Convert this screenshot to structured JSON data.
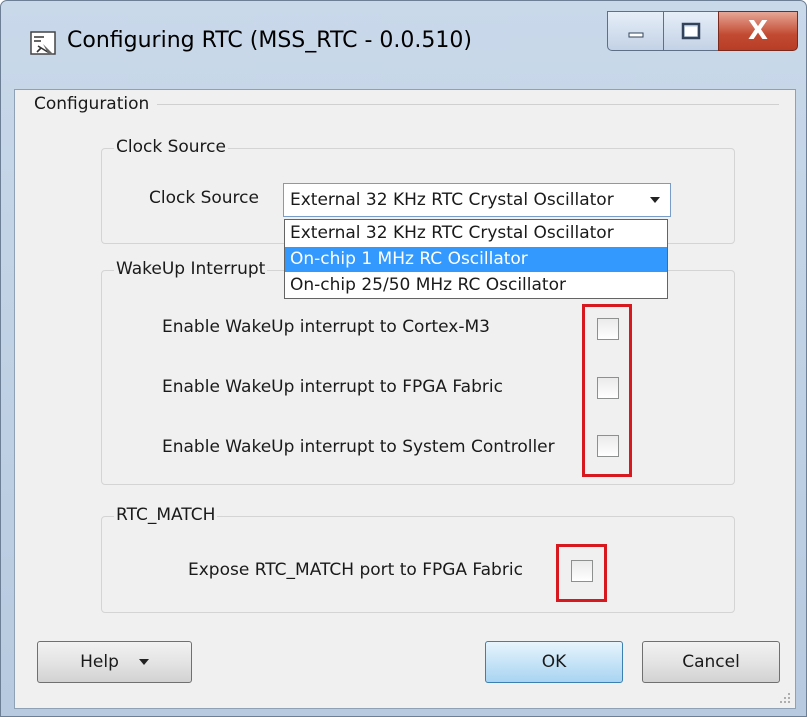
{
  "window": {
    "title": "Configuring RTC (MSS_RTC - 0.0.510)",
    "close_glyph": "X"
  },
  "configuration": {
    "title": "Configuration"
  },
  "clock_source_group": {
    "title": "Clock Source",
    "field_label": "Clock Source",
    "selected_value": "External 32 KHz RTC Crystal Oscillator",
    "options": [
      "External 32 KHz RTC Crystal Oscillator",
      "On-chip 1 MHz RC Oscillator",
      "On-chip 25/50 MHz RC Oscillator"
    ],
    "highlighted_option": "On-chip 1 MHz RC Oscillator"
  },
  "wakeup_group": {
    "title": "WakeUp Interrupt",
    "items": [
      {
        "label": "Enable WakeUp interrupt to Cortex-M3",
        "checked": false
      },
      {
        "label": "Enable WakeUp interrupt to FPGA Fabric",
        "checked": false
      },
      {
        "label": "Enable WakeUp interrupt to System Controller",
        "checked": false
      }
    ]
  },
  "rtc_match_group": {
    "title": "RTC_MATCH",
    "items": [
      {
        "label": "Expose RTC_MATCH port to FPGA Fabric",
        "checked": false
      }
    ]
  },
  "buttons": {
    "help": "Help",
    "ok": "OK",
    "cancel": "Cancel"
  },
  "colors": {
    "highlight_box": "#d7191f",
    "selection": "#3399ff",
    "title_bar": "#c9d9ea"
  }
}
